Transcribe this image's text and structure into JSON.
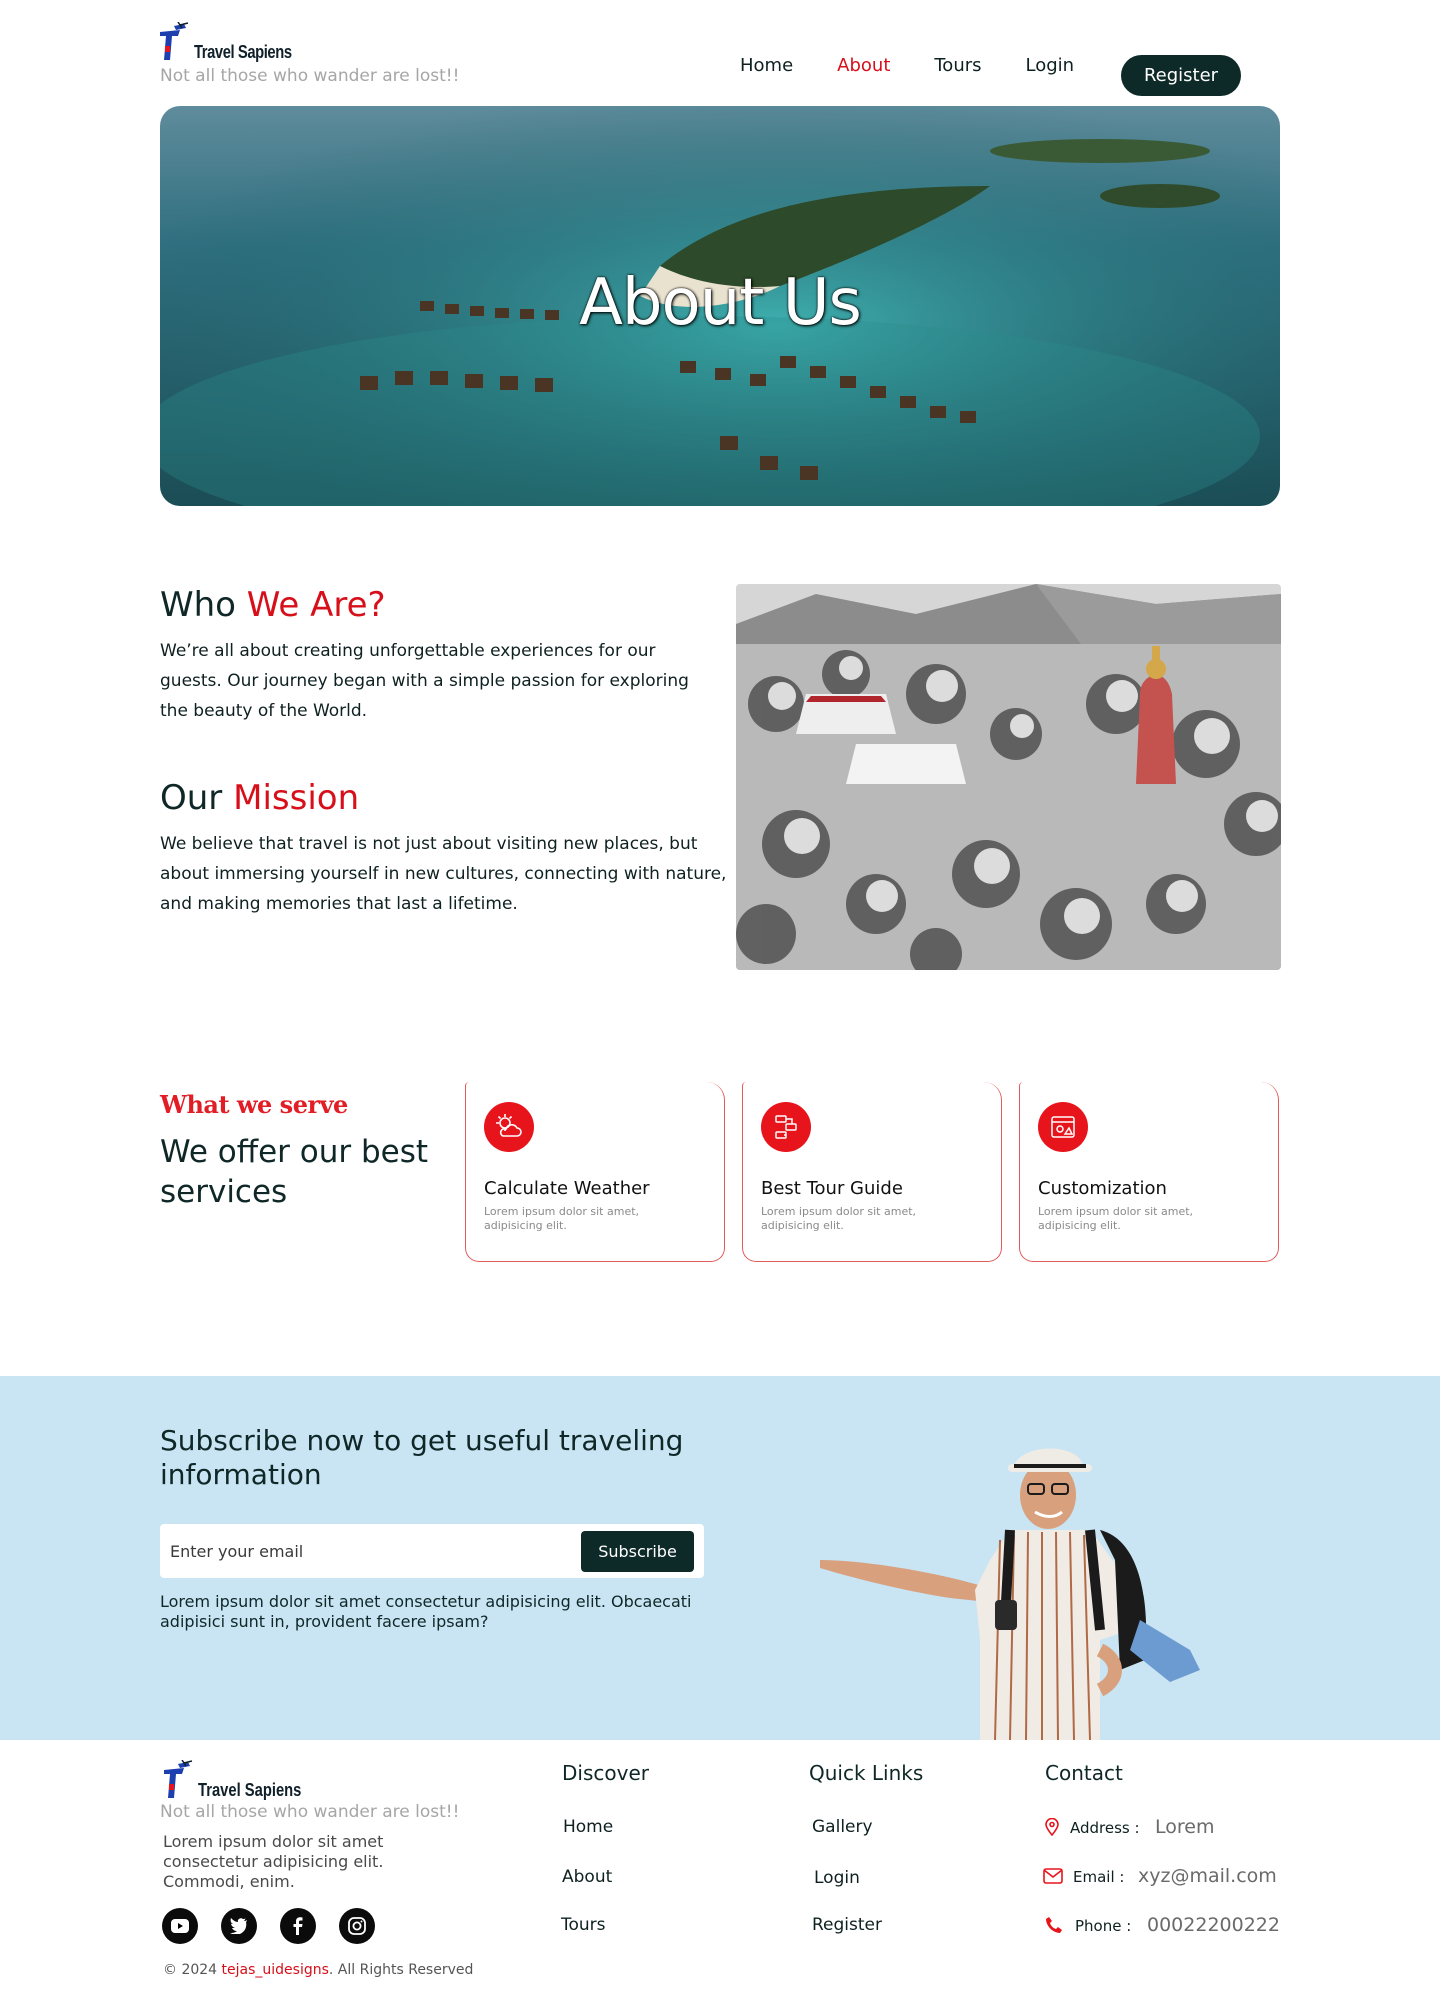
{
  "header": {
    "brand": "Travel Sapiens",
    "tagline": "Not all those who wander are lost!!",
    "nav": [
      "Home",
      "About",
      "Tours",
      "Login"
    ],
    "active_nav": "About",
    "register_label": "Register"
  },
  "hero": {
    "title": "About Us"
  },
  "who": {
    "title_plain": "Who ",
    "title_accent": "We Are?",
    "text": "We’re all about creating unforgettable experiences for our guests. Our journey began with a simple passion for exploring the beauty of the World."
  },
  "mission": {
    "title_plain": "Our ",
    "title_accent": "Mission",
    "text": "We believe that travel is not just about visiting new places, but about immersing yourself in new cultures, connecting with nature, and making memories that last a lifetime."
  },
  "services": {
    "eyebrow": "What we serve",
    "title": "We offer our best services",
    "cards": [
      {
        "title": "Calculate Weather",
        "desc": "Lorem ipsum dolor sit amet, adipisicing elit.",
        "icon": "weather-icon"
      },
      {
        "title": "Best Tour Guide",
        "desc": "Lorem ipsum dolor sit amet, adipisicing elit.",
        "icon": "route-icon"
      },
      {
        "title": "Customization",
        "desc": "Lorem ipsum dolor sit amet, adipisicing elit.",
        "icon": "customize-icon"
      }
    ]
  },
  "subscribe": {
    "title": "Subscribe now to get useful traveling information",
    "placeholder": "Enter your email",
    "button": "Subscribe",
    "note": "Lorem ipsum dolor sit amet consectetur adipisicing elit. Obcaecati adipisici sunt in, provident facere ipsam?"
  },
  "footer": {
    "brand": "Travel Sapiens",
    "tagline": "Not all those who wander are lost!!",
    "desc": "Lorem ipsum dolor sit amet consectetur adipisicing elit. Commodi, enim.",
    "social": [
      "youtube-icon",
      "twitter-icon",
      "facebook-icon",
      "instagram-icon"
    ],
    "copyright_prefix": "© 2024 ",
    "copyright_link": "tejas_uidesigns",
    "copyright_suffix": ". All Rights Reserved",
    "discover": {
      "title": "Discover",
      "links": [
        "Home",
        "About",
        "Tours"
      ]
    },
    "quick": {
      "title": "Quick Links",
      "links": [
        "Gallery",
        "Login",
        "Register"
      ]
    },
    "contact": {
      "title": "Contact",
      "address_label": "Address :",
      "address_value": "Lorem",
      "email_label": "Email :",
      "email_value": "xyz@mail.com",
      "phone_label": "Phone :",
      "phone_value": "00022200222"
    }
  },
  "colors": {
    "accent": "#d70f1a",
    "dark": "#0d2a28",
    "band": "#c9e4f3"
  }
}
